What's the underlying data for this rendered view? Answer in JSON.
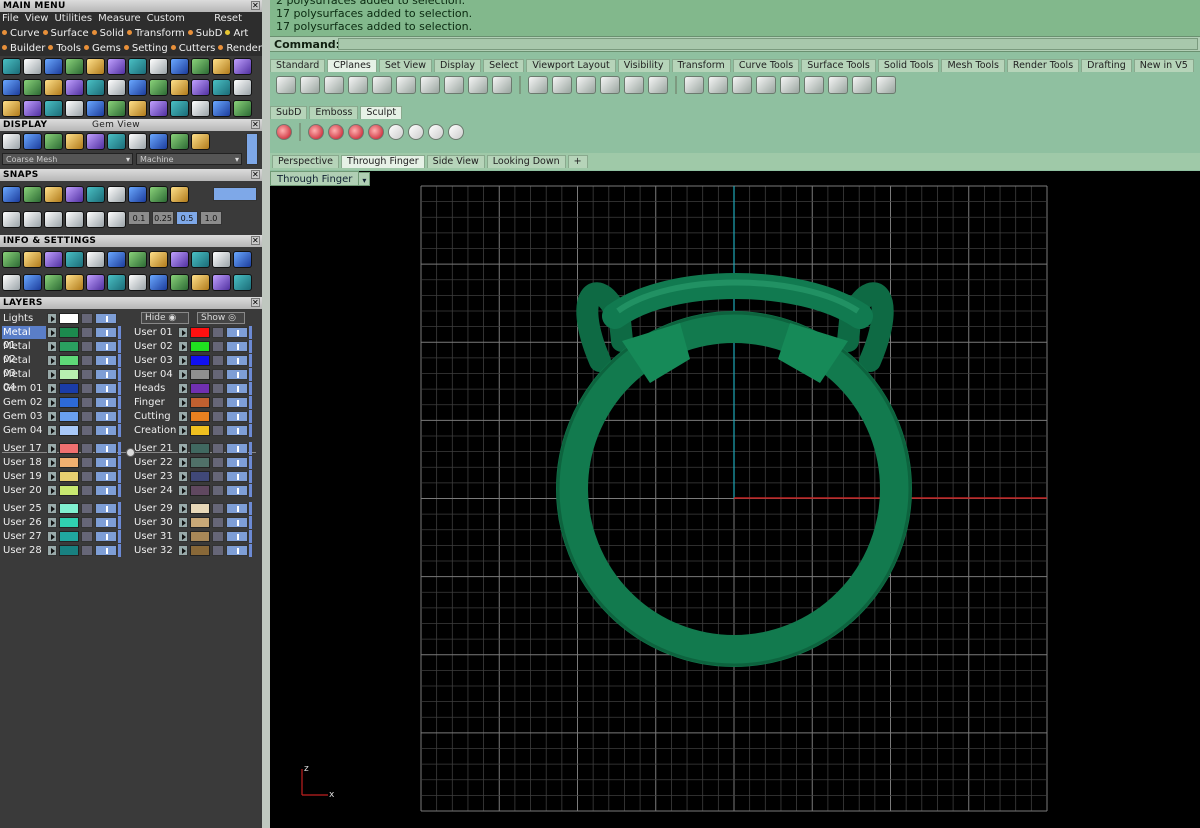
{
  "main_menu": {
    "title": "MAIN MENU",
    "items": [
      "File",
      "View",
      "Utilities",
      "Measure",
      "Custom"
    ],
    "reset": "Reset",
    "tabs_row1": [
      "Curve",
      "Surface",
      "Solid",
      "Transform",
      "SubD",
      "Art"
    ],
    "tabs_row2": [
      "Builder",
      "Tools",
      "Gems",
      "Setting",
      "Cutters",
      "Render"
    ]
  },
  "display": {
    "title": "DISPLAY",
    "subtitle": "Gem View",
    "mesh_combo": "Coarse Mesh",
    "machine_combo": "Machine"
  },
  "snaps": {
    "title": "SNAPS",
    "values": [
      "0.1",
      "0.25",
      "0.5",
      "1.0"
    ]
  },
  "info": {
    "title": "INFO & SETTINGS"
  },
  "layers": {
    "title": "LAYERS",
    "lights": "Lights",
    "hide": "Hide",
    "show": "Show",
    "left": [
      [
        {
          "name": "Metal 01",
          "color": "#1c8a4e",
          "selected": true
        },
        {
          "name": "Metal 02",
          "color": "#2aa060"
        },
        {
          "name": "Metal 03",
          "color": "#5ed878"
        },
        {
          "name": "Metal 04",
          "color": "#b8f0b0"
        }
      ],
      [
        {
          "name": "Gem 01",
          "color": "#1a3ca8"
        },
        {
          "name": "Gem 02",
          "color": "#2d6ad8"
        },
        {
          "name": "Gem 03",
          "color": "#6aa0f0"
        },
        {
          "name": "Gem 04",
          "color": "#a8c8f8"
        }
      ],
      [
        {
          "name": "User 17",
          "color": "#f07070"
        },
        {
          "name": "User 18",
          "color": "#f0b070"
        },
        {
          "name": "User 19",
          "color": "#e8d070"
        },
        {
          "name": "User 20",
          "color": "#c8e870"
        }
      ],
      [
        {
          "name": "User 25",
          "color": "#80f0d0"
        },
        {
          "name": "User 26",
          "color": "#30d0b0"
        },
        {
          "name": "User 27",
          "color": "#20a8a0"
        },
        {
          "name": "User 28",
          "color": "#188080"
        }
      ]
    ],
    "right": [
      [
        {
          "name": "User 01",
          "color": "#ff1010"
        },
        {
          "name": "User 02",
          "color": "#20e020"
        },
        {
          "name": "User 03",
          "color": "#1010f0"
        },
        {
          "name": "User 04",
          "color": "#909090"
        }
      ],
      [
        {
          "name": "Heads",
          "color": "#7030b0"
        },
        {
          "name": "Finger",
          "color": "#c06030"
        },
        {
          "name": "Cutting",
          "color": "#e88020"
        },
        {
          "name": "Creation",
          "color": "#f0c020"
        }
      ],
      [
        {
          "name": "User 21",
          "color": "#406860"
        },
        {
          "name": "User 22",
          "color": "#507068"
        },
        {
          "name": "User 23",
          "color": "#404878"
        },
        {
          "name": "User 24",
          "color": "#604860"
        }
      ],
      [
        {
          "name": "User 29",
          "color": "#e8d8b8"
        },
        {
          "name": "User 30",
          "color": "#c8a878"
        },
        {
          "name": "User 31",
          "color": "#a88858"
        },
        {
          "name": "User 32",
          "color": "#886838"
        }
      ]
    ]
  },
  "command": {
    "history": [
      "2 polysurfaces added to selection.",
      "17 polysurfaces added to selection.",
      "17 polysurfaces added to selection."
    ],
    "label": "Command:"
  },
  "toolbar_tabs": [
    "Standard",
    "CPlanes",
    "Set View",
    "Display",
    "Select",
    "Viewport Layout",
    "Visibility",
    "Transform",
    "Curve Tools",
    "Surface Tools",
    "Solid Tools",
    "Mesh Tools",
    "Render Tools",
    "Drafting",
    "New in V5"
  ],
  "toolbar_active": "CPlanes",
  "sub_tabs": [
    "SubD",
    "Emboss",
    "Sculpt"
  ],
  "sub_active": "Sculpt",
  "viewport_tabs": [
    "Perspective",
    "Through Finger",
    "Side View",
    "Looking Down",
    "+"
  ],
  "viewport_active": "Through Finger",
  "viewport_title": "Through Finger",
  "axis": {
    "z": "z",
    "x": "x"
  },
  "colors": {
    "model": "#137a50",
    "model_light": "#2fa070",
    "grid": "#5a5a5a",
    "axis_x": "#c02020",
    "axis_y": "#20a0b0"
  }
}
